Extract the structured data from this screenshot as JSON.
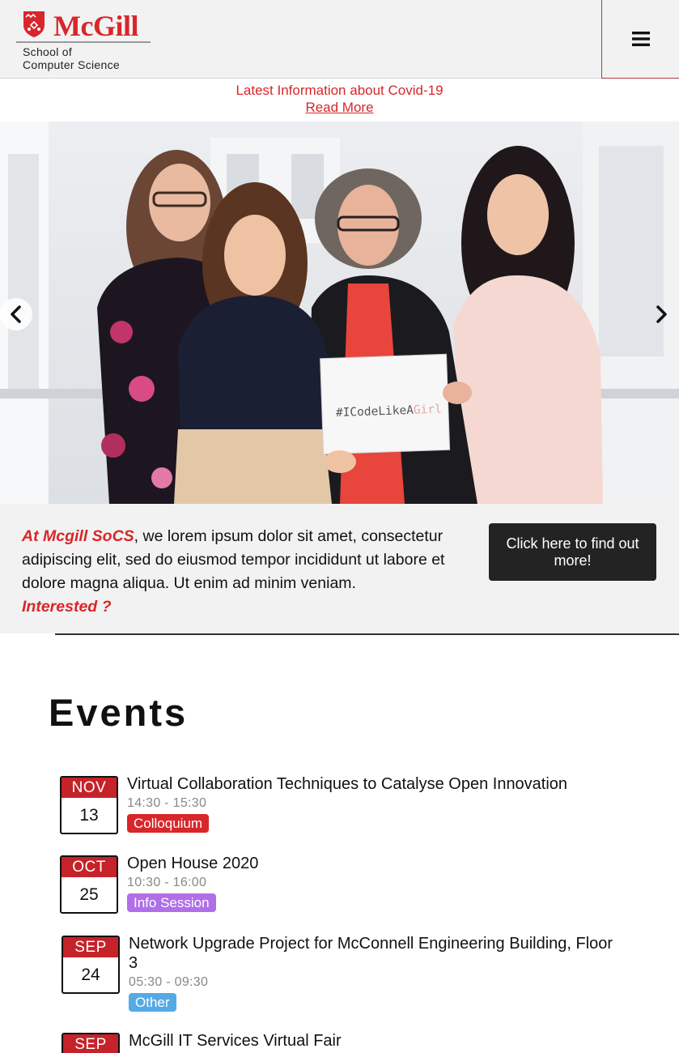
{
  "header": {
    "logo_word": "McGill",
    "logo_sub_line1": "School of",
    "logo_sub_line2": "Computer Science",
    "menu_icon": "hamburger-menu-icon"
  },
  "notice": {
    "text": "Latest Information about Covid-19",
    "link": "Read More"
  },
  "hero": {
    "sign_prefix": "#ICodeLikeA",
    "sign_suffix": "Girl",
    "prev_icon": "chevron-left-icon",
    "next_icon": "chevron-right-icon"
  },
  "intro": {
    "lead": "At Mcgill SoCS",
    "body": ", we lorem ipsum dolor sit amet, consectetur adipiscing elit, sed do eiusmod tempor incididunt ut labore et dolore magna aliqua. Ut enim ad minim veniam.",
    "interested": "Interested ?",
    "cta": "Click here to find out more!"
  },
  "events": {
    "title": "Events",
    "items": [
      {
        "month": "NOV",
        "day": "13",
        "title": "Virtual Collaboration Techniques to Catalyse Open Innovation",
        "time": "14:30 - 15:30",
        "tag": "Colloquium",
        "tag_color": "#d8262a"
      },
      {
        "month": "OCT",
        "day": "25",
        "title": "Open House 2020",
        "time": "10:30 - 16:00",
        "tag": "Info Session",
        "tag_color": "#b06fe8"
      },
      {
        "month": "SEP",
        "day": "24",
        "title": "Network Upgrade Project for McConnell Engineering Building, Floor 3",
        "time": "05:30 - 09:30",
        "tag": "Other",
        "tag_color": "#55aae6"
      },
      {
        "month": "SEP",
        "day": "",
        "title": "McGill IT Services Virtual Fair",
        "time": "",
        "tag": "",
        "tag_color": "#d8262a"
      }
    ]
  },
  "colors": {
    "brand_red": "#d8262a",
    "calendar_red": "#c5222a",
    "cta_bg": "#232323",
    "band_bg": "#f2f2f2"
  }
}
